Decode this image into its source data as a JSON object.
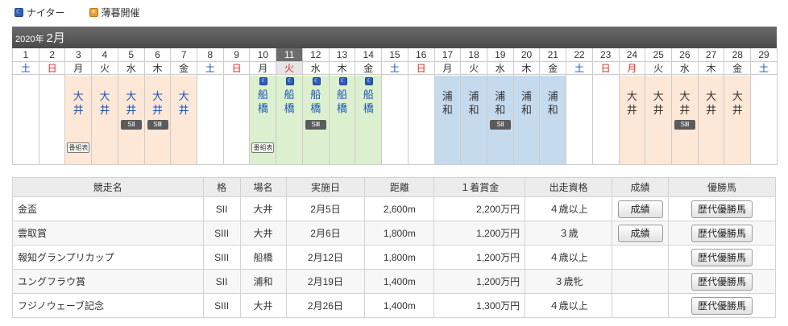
{
  "legend": {
    "night_label": "ナイター",
    "dusk_label": "薄暮開催"
  },
  "header": {
    "year": "2020年",
    "month": "2月"
  },
  "calendar": {
    "days": [
      {
        "num": "1",
        "wd": "土",
        "wdtype": "sat",
        "cell": "blank"
      },
      {
        "num": "2",
        "wd": "日",
        "wdtype": "sun",
        "cell": "blank"
      },
      {
        "num": "3",
        "wd": "月",
        "wdtype": "normal",
        "cell": "ooi",
        "venue": [
          "大",
          "井"
        ],
        "venue_color": "blue",
        "bangumi": "番組表"
      },
      {
        "num": "4",
        "wd": "火",
        "wdtype": "normal",
        "cell": "ooi",
        "venue": [
          "大",
          "井"
        ],
        "venue_color": "blue"
      },
      {
        "num": "5",
        "wd": "水",
        "wdtype": "normal",
        "cell": "ooi",
        "venue": [
          "大",
          "井"
        ],
        "venue_color": "blue",
        "badge": "SⅡ"
      },
      {
        "num": "6",
        "wd": "木",
        "wdtype": "normal",
        "cell": "ooi",
        "venue": [
          "大",
          "井"
        ],
        "venue_color": "blue",
        "badge": "SⅢ"
      },
      {
        "num": "7",
        "wd": "金",
        "wdtype": "normal",
        "cell": "ooi",
        "venue": [
          "大",
          "井"
        ],
        "venue_color": "blue"
      },
      {
        "num": "8",
        "wd": "土",
        "wdtype": "sat",
        "cell": "blank"
      },
      {
        "num": "9",
        "wd": "日",
        "wdtype": "sun",
        "cell": "blank"
      },
      {
        "num": "10",
        "wd": "月",
        "wdtype": "normal",
        "cell": "funabashi",
        "venue": [
          "船",
          "橋"
        ],
        "venue_color": "blue",
        "night": true,
        "bangumi": "番組表"
      },
      {
        "num": "11",
        "wd": "火",
        "wdtype": "sun",
        "cell": "funabashi",
        "venue": [
          "船",
          "橋"
        ],
        "venue_color": "blue",
        "night": true,
        "today": true
      },
      {
        "num": "12",
        "wd": "水",
        "wdtype": "normal",
        "cell": "funabashi",
        "venue": [
          "船",
          "橋"
        ],
        "venue_color": "blue",
        "night": true,
        "badge": "SⅢ"
      },
      {
        "num": "13",
        "wd": "木",
        "wdtype": "normal",
        "cell": "funabashi",
        "venue": [
          "船",
          "橋"
        ],
        "venue_color": "blue",
        "night": true
      },
      {
        "num": "14",
        "wd": "金",
        "wdtype": "normal",
        "cell": "funabashi",
        "venue": [
          "船",
          "橋"
        ],
        "venue_color": "blue",
        "night": true
      },
      {
        "num": "15",
        "wd": "土",
        "wdtype": "sat",
        "cell": "blank"
      },
      {
        "num": "16",
        "wd": "日",
        "wdtype": "sun",
        "cell": "blank"
      },
      {
        "num": "17",
        "wd": "月",
        "wdtype": "normal",
        "cell": "urawa",
        "venue": [
          "浦",
          "和"
        ],
        "venue_color": "dark"
      },
      {
        "num": "18",
        "wd": "火",
        "wdtype": "normal",
        "cell": "urawa",
        "venue": [
          "浦",
          "和"
        ],
        "venue_color": "dark"
      },
      {
        "num": "19",
        "wd": "水",
        "wdtype": "normal",
        "cell": "urawa",
        "venue": [
          "浦",
          "和"
        ],
        "venue_color": "dark",
        "badge": "SⅡ"
      },
      {
        "num": "20",
        "wd": "木",
        "wdtype": "normal",
        "cell": "urawa",
        "venue": [
          "浦",
          "和"
        ],
        "venue_color": "dark"
      },
      {
        "num": "21",
        "wd": "金",
        "wdtype": "normal",
        "cell": "urawa",
        "venue": [
          "浦",
          "和"
        ],
        "venue_color": "dark"
      },
      {
        "num": "22",
        "wd": "土",
        "wdtype": "sat",
        "cell": "blank"
      },
      {
        "num": "23",
        "wd": "日",
        "wdtype": "sun",
        "cell": "blank"
      },
      {
        "num": "24",
        "wd": "月",
        "wdtype": "sun",
        "cell": "ooi",
        "venue": [
          "大",
          "井"
        ],
        "venue_color": "dark"
      },
      {
        "num": "25",
        "wd": "火",
        "wdtype": "normal",
        "cell": "ooi",
        "venue": [
          "大",
          "井"
        ],
        "venue_color": "dark"
      },
      {
        "num": "26",
        "wd": "水",
        "wdtype": "normal",
        "cell": "ooi",
        "venue": [
          "大",
          "井"
        ],
        "venue_color": "dark",
        "badge": "SⅢ"
      },
      {
        "num": "27",
        "wd": "木",
        "wdtype": "normal",
        "cell": "ooi",
        "venue": [
          "大",
          "井"
        ],
        "venue_color": "dark"
      },
      {
        "num": "28",
        "wd": "金",
        "wdtype": "normal",
        "cell": "ooi",
        "venue": [
          "大",
          "井"
        ],
        "venue_color": "dark"
      },
      {
        "num": "29",
        "wd": "土",
        "wdtype": "sat",
        "cell": "blank"
      }
    ]
  },
  "table": {
    "headers": [
      "競走名",
      "格",
      "場名",
      "実施日",
      "距離",
      "１着賞金",
      "出走資格",
      "成績",
      "優勝馬"
    ],
    "result_label": "成績",
    "winners_label": "歴代優勝馬",
    "rows": [
      {
        "name": "金盃",
        "grade": "SII",
        "venue": "大井",
        "date": "2月5日",
        "distance": "2,600m",
        "prize": "2,200万円",
        "eligibility": "４歳以上",
        "has_result": true
      },
      {
        "name": "雲取賞",
        "grade": "SIII",
        "venue": "大井",
        "date": "2月6日",
        "distance": "1,800m",
        "prize": "1,200万円",
        "eligibility": "３歳",
        "has_result": true
      },
      {
        "name": "報知グランプリカップ",
        "grade": "SIII",
        "venue": "船橋",
        "date": "2月12日",
        "distance": "1,800m",
        "prize": "1,200万円",
        "eligibility": "４歳以上",
        "has_result": false
      },
      {
        "name": "ユングフラウ賞",
        "grade": "SII",
        "venue": "浦和",
        "date": "2月19日",
        "distance": "1,400m",
        "prize": "1,200万円",
        "eligibility": "３歳牝",
        "has_result": false
      },
      {
        "name": "フジノウェーブ記念",
        "grade": "SIII",
        "venue": "大井",
        "date": "2月26日",
        "distance": "1,400m",
        "prize": "1,300万円",
        "eligibility": "４歳以上",
        "has_result": false
      }
    ]
  }
}
